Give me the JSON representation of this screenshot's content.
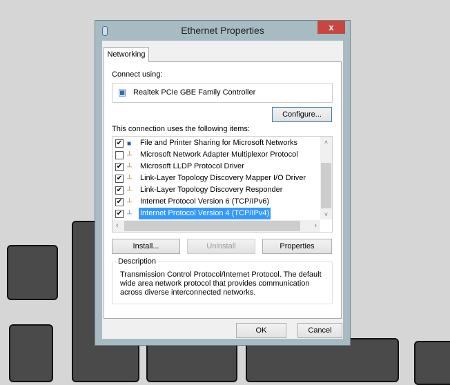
{
  "window": {
    "title": "Ethernet Properties",
    "close": "x"
  },
  "tabs": [
    {
      "label": "Networking"
    }
  ],
  "connect_using": {
    "label": "Connect using:",
    "adapter": "Realtek PCIe GBE Family Controller",
    "configure": "Configure..."
  },
  "items": {
    "label": "This connection uses the following items:",
    "list": [
      {
        "label": "File and Printer Sharing for Microsoft Networks",
        "checked": true
      },
      {
        "label": "Microsoft Network Adapter Multiplexor Protocol",
        "checked": false
      },
      {
        "label": "Microsoft LLDP Protocol Driver",
        "checked": true
      },
      {
        "label": "Link-Layer Topology Discovery Mapper I/O Driver",
        "checked": true
      },
      {
        "label": "Link-Layer Topology Discovery Responder",
        "checked": true
      },
      {
        "label": "Internet Protocol Version 6 (TCP/IPv6)",
        "checked": true
      },
      {
        "label": "Internet Protocol Version 4 (TCP/IPv4)",
        "checked": true,
        "selected": true
      }
    ]
  },
  "buttons": {
    "install": "Install...",
    "uninstall": "Uninstall",
    "properties": "Properties",
    "ok": "OK",
    "cancel": "Cancel"
  },
  "description": {
    "label": "Description",
    "text": "Transmission Control Protocol/Internet Protocol. The default wide area network protocol that provides communication across diverse interconnected networks."
  },
  "check": "✔"
}
